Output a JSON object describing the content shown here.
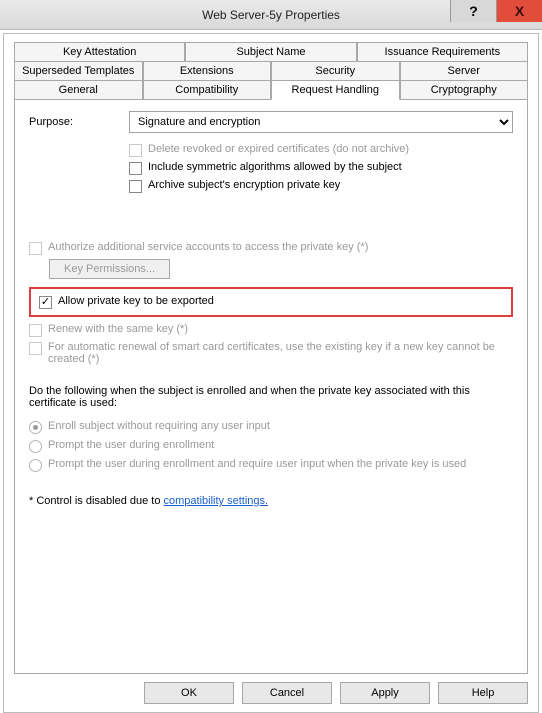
{
  "title": "Web Server-5y Properties",
  "titlebar": {
    "help": "?",
    "close": "X"
  },
  "tabs": {
    "row1": [
      "Key Attestation",
      "Subject Name",
      "Issuance Requirements"
    ],
    "row2": [
      "Superseded Templates",
      "Extensions",
      "Security",
      "Server"
    ],
    "row3": [
      "General",
      "Compatibility",
      "Request Handling",
      "Cryptography"
    ]
  },
  "active_tab": "Request Handling",
  "purpose": {
    "label": "Purpose:",
    "value": "Signature and encryption"
  },
  "chk_delete": "Delete revoked or expired certificates (do not archive)",
  "chk_include": "Include symmetric algorithms allowed by the subject",
  "chk_archive": "Archive subject's encryption private key",
  "chk_authorize": "Authorize additional service accounts to access the private key (*)",
  "btn_key_perms": "Key Permissions...",
  "chk_allow_export": "Allow private key to be exported",
  "chk_renew": "Renew with the same key (*)",
  "chk_auto_renew": "For automatic renewal of smart card certificates, use the existing key if a new key cannot be created (*)",
  "do_following": "Do the following when the subject is enrolled and when the private key associated with this certificate is used:",
  "radio_enroll": "Enroll subject without requiring any user input",
  "radio_prompt1": "Prompt the user during enrollment",
  "radio_prompt2": "Prompt the user during enrollment and require user input when the private key is used",
  "footnote_prefix": "* Control is disabled due to ",
  "footnote_link": "compatibility settings.",
  "buttons": {
    "ok": "OK",
    "cancel": "Cancel",
    "apply": "Apply",
    "help": "Help"
  }
}
